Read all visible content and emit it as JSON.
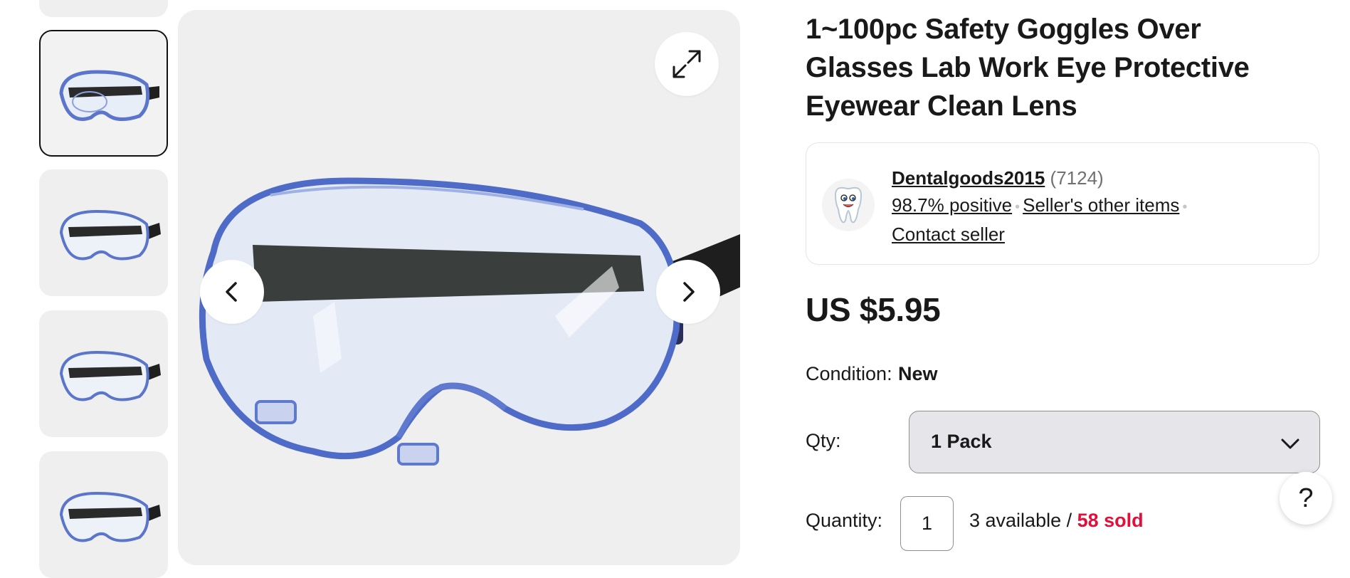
{
  "product": {
    "title": "1~100pc Safety Goggles Over Glasses Lab Work Eye Protective Eyewear Clean Lens"
  },
  "gallery": {
    "thumbnails": [
      "goggles-thumb-1",
      "goggles-thumb-2",
      "goggles-thumb-3",
      "goggles-thumb-4",
      "goggles-thumb-5"
    ],
    "selected_index": 1,
    "icons": {
      "expand": "expand-icon",
      "prev": "chevron-left-icon",
      "next": "chevron-right-icon"
    }
  },
  "seller": {
    "name": "Dentalgoods2015",
    "feedback_count": "(7124)",
    "positive": "98.7% positive",
    "other_items": "Seller's other items",
    "contact": "Contact seller",
    "avatar_icon": "tooth-mascot-icon"
  },
  "price": "US $5.95",
  "condition": {
    "label": "Condition:",
    "value": "New"
  },
  "qty": {
    "label": "Qty:",
    "selected": "1 Pack"
  },
  "quantity": {
    "label": "Quantity:",
    "value": "1",
    "available": "3 available / ",
    "sold": "58 sold"
  },
  "help": "?",
  "colors": {
    "sold": "#e0103a",
    "select_bg": "#e5e5ea"
  }
}
